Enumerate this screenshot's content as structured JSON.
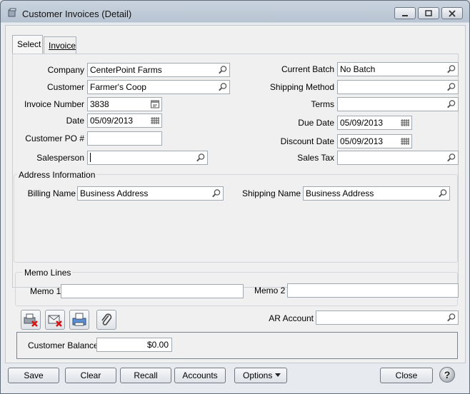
{
  "window": {
    "title": "Customer Invoices (Detail)",
    "app_icon": "app-icon",
    "controls": [
      "minimize",
      "maximize",
      "close"
    ]
  },
  "tabs": [
    {
      "label": "Select",
      "active": true
    },
    {
      "label": "Invoice",
      "active": false
    }
  ],
  "left_fields": {
    "company": {
      "label": "Company",
      "value": "CenterPoint Farms"
    },
    "customer": {
      "label": "Customer",
      "value": "Farmer's Coop"
    },
    "invoice_number": {
      "label": "Invoice Number",
      "value": "3838"
    },
    "date": {
      "label": "Date",
      "value": "05/09/2013"
    },
    "customer_po": {
      "label": "Customer PO #",
      "value": ""
    },
    "salesperson": {
      "label": "Salesperson",
      "value": ""
    }
  },
  "right_fields": {
    "current_batch": {
      "label": "Current Batch",
      "value": "No Batch"
    },
    "shipping_method": {
      "label": "Shipping Method",
      "value": ""
    },
    "terms": {
      "label": "Terms",
      "value": ""
    },
    "due_date": {
      "label": "Due Date",
      "value": "05/09/2013"
    },
    "discount_date": {
      "label": "Discount Date",
      "value": "05/09/2013"
    },
    "sales_tax": {
      "label": "Sales Tax",
      "value": ""
    }
  },
  "address": {
    "group_title": "Address Information",
    "billing": {
      "label": "Billing Name",
      "value": "Business Address"
    },
    "shipping": {
      "label": "Shipping Name",
      "value": "Business Address"
    }
  },
  "memo": {
    "group_title": "Memo Lines",
    "memo1": {
      "label": "Memo 1",
      "value": ""
    },
    "memo2": {
      "label": "Memo 2",
      "value": ""
    }
  },
  "toolbar_icons": [
    "delete-printer-icon",
    "delete-email-icon",
    "printer-icon",
    "paperclip-icon"
  ],
  "ar_account": {
    "label": "AR Account",
    "value": ""
  },
  "balance": {
    "label": "Customer Balance",
    "value": "$0.00"
  },
  "buttons": {
    "save": "Save",
    "clear": "Clear",
    "recall": "Recall",
    "accounts": "Accounts",
    "options": "Options",
    "close": "Close",
    "help": "?"
  }
}
